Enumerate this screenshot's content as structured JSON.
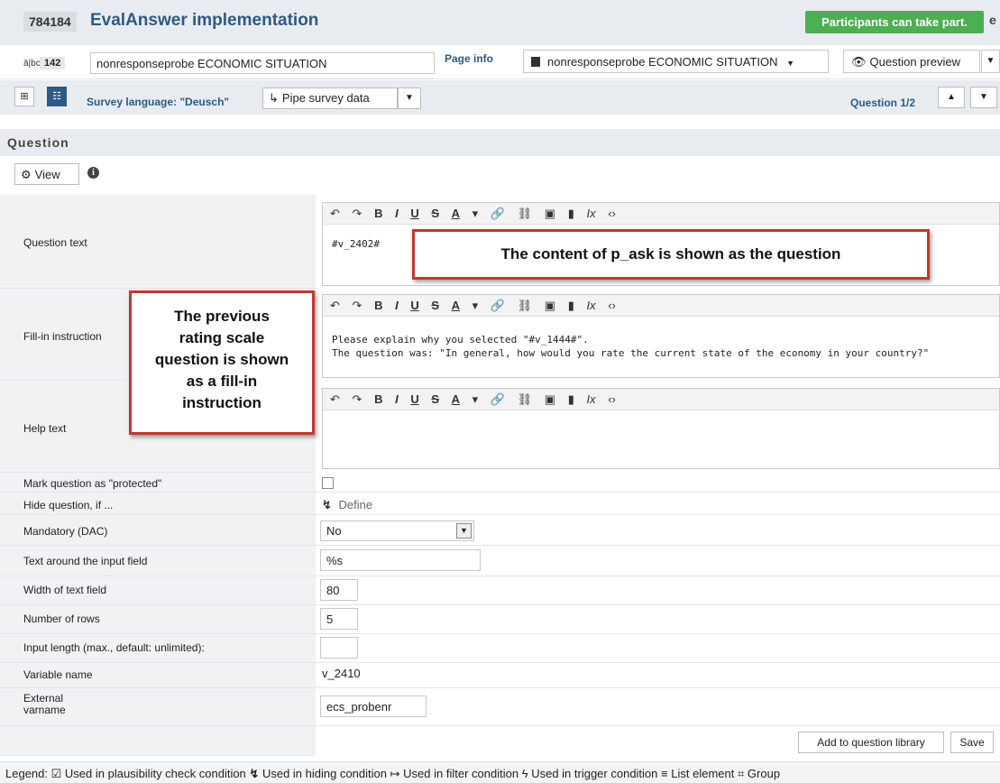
{
  "header": {
    "id": "784184",
    "title": "EvalAnswer implementation",
    "status": "Participants can take part.",
    "status_extra": "e"
  },
  "page": {
    "icon_text": "ā|bc",
    "number": "142",
    "name": "nonresponseprobe ECONOMIC SITUATION",
    "info_label": "Page info",
    "select_value": "nonresponseprobe ECONOMIC SITUATION",
    "preview_label": "Question preview"
  },
  "language_bar": {
    "language_label": "Survey language: \"Deusch\"",
    "pipe_label": "Pipe survey data",
    "question_count": "Question 1/2"
  },
  "section": {
    "title": "Question",
    "view_label": "View"
  },
  "fields": {
    "question_text_label": "Question text",
    "question_text_value": "#v_2402#",
    "fillin_label": "Fill-in instruction",
    "fillin_line1": "Please explain why you selected \"#v_1444#\".",
    "fillin_line2": "The question was: \"In general, how would you rate the current state of the economy in your country?\"",
    "help_label": "Help text",
    "protected_label": "Mark question as \"protected\"",
    "hide_label": "Hide question, if ...",
    "define_label": "Define",
    "mandatory_label": "Mandatory (DAC)",
    "mandatory_value": "No",
    "text_around_label": "Text around the input field",
    "text_around_value": "%s",
    "width_label": "Width of text field",
    "width_value": "80",
    "rows_label": "Number of rows",
    "rows_value": "5",
    "input_length_label": "Input length (max., default: unlimited):",
    "input_length_value": "",
    "varname_label": "Variable name",
    "varname_value": "v_2410",
    "external_label_1": "External",
    "external_label_2": "varname",
    "external_value": "ecs_probenr"
  },
  "toolbar": {
    "undo": "↶",
    "redo": "↷",
    "bold": "B",
    "italic": "I",
    "underline": "U",
    "strike": "S",
    "color": "A",
    "color_drop": "▾",
    "link": "🔗",
    "unlink": "⛓",
    "image": "▣",
    "block": "▮",
    "clear": "Ix",
    "source": "‹›"
  },
  "callouts": {
    "question": "The content of p_ask is shown as the question",
    "fillin_lines": [
      "The previous",
      "rating scale",
      "question is shown",
      "as a fill-in",
      "instruction"
    ]
  },
  "buttons": {
    "add_library": "Add to question library",
    "save": "Save"
  },
  "legend": {
    "prefix": "Legend:",
    "items": [
      "Used in plausibility check condition",
      "Used in hiding condition",
      "Used in filter condition",
      "Used in trigger condition",
      "List element",
      "Group"
    ]
  },
  "colors": {
    "accent": "#2d5a86",
    "status_green": "#4caf50",
    "callout_red": "#c0392b"
  }
}
